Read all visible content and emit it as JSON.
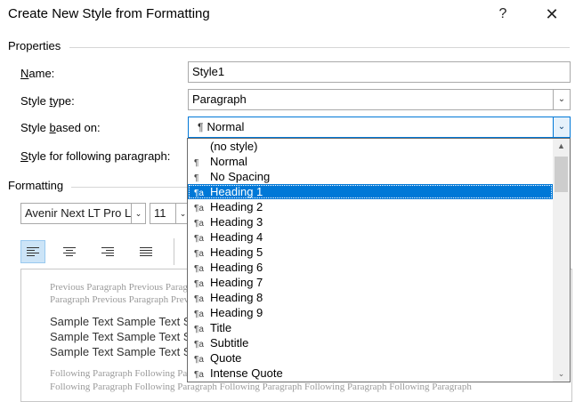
{
  "window": {
    "title": "Create New Style from Formatting",
    "help_label": "?",
    "close_label": "✕"
  },
  "properties": {
    "section_label": "Properties",
    "name_label_underlined": "N",
    "name_label_rest": "ame:",
    "name_value": "Style1",
    "style_type_label_a": "Style ",
    "style_type_label_u": "t",
    "style_type_label_b": "ype:",
    "style_type_value": "Paragraph",
    "based_on_label_a": "Style ",
    "based_on_label_u": "b",
    "based_on_label_b": "ased on:",
    "based_on_glyph": "¶",
    "based_on_value": "Normal",
    "following_label_a": "",
    "following_label_u": "S",
    "following_label_b": "tyle for following paragraph:"
  },
  "formatting": {
    "section_label": "Formatting",
    "font_value": "Avenir Next LT Pro L",
    "size_value": "11"
  },
  "preview": {
    "previous_line_1": "Previous Paragraph Previous Paragraph Previous Paragraph Previous Paragraph Previous Paragraph Previous",
    "previous_line_2": "Paragraph Previous Paragraph Previous Paragraph Previous Paragraph Previous Paragraph",
    "sample_line_1": "Sample Text Sample Text Sample Text Sample Text Sample Text Sample Text Sample Text",
    "sample_line_2": "Sample Text Sample Text Sample Text Sample Text Sample Text Sample Text Sample Text",
    "sample_line_3": "Sample Text Sample Text Sample Text Sample Text Sample Text",
    "following_line_1": "Following Paragraph Following Paragraph Following Paragraph Following Paragraph Following Paragraph",
    "following_line_2": "Following Paragraph Following Paragraph Following Paragraph Following Paragraph Following Paragraph"
  },
  "dropdown": {
    "items": [
      {
        "glyph": "",
        "label": "(no style)"
      },
      {
        "glyph": "¶",
        "label": "Normal"
      },
      {
        "glyph": "¶",
        "label": "No Spacing"
      },
      {
        "glyph": "¶a",
        "label": "Heading 1"
      },
      {
        "glyph": "¶a",
        "label": "Heading 2"
      },
      {
        "glyph": "¶a",
        "label": "Heading 3"
      },
      {
        "glyph": "¶a",
        "label": "Heading 4"
      },
      {
        "glyph": "¶a",
        "label": "Heading 5"
      },
      {
        "glyph": "¶a",
        "label": "Heading 6"
      },
      {
        "glyph": "¶a",
        "label": "Heading 7"
      },
      {
        "glyph": "¶a",
        "label": "Heading 8"
      },
      {
        "glyph": "¶a",
        "label": "Heading 9"
      },
      {
        "glyph": "¶a",
        "label": "Title"
      },
      {
        "glyph": "¶a",
        "label": "Subtitle"
      },
      {
        "glyph": "¶a",
        "label": "Quote"
      },
      {
        "glyph": "¶a",
        "label": "Intense Quote"
      }
    ],
    "selected_label": "Heading 1",
    "icons": {
      "up": "scroll-up-arrow-icon",
      "down": "scroll-down-arrow-icon"
    }
  },
  "colors": {
    "accent": "#0078d7",
    "selection_text": "#ffffff"
  }
}
